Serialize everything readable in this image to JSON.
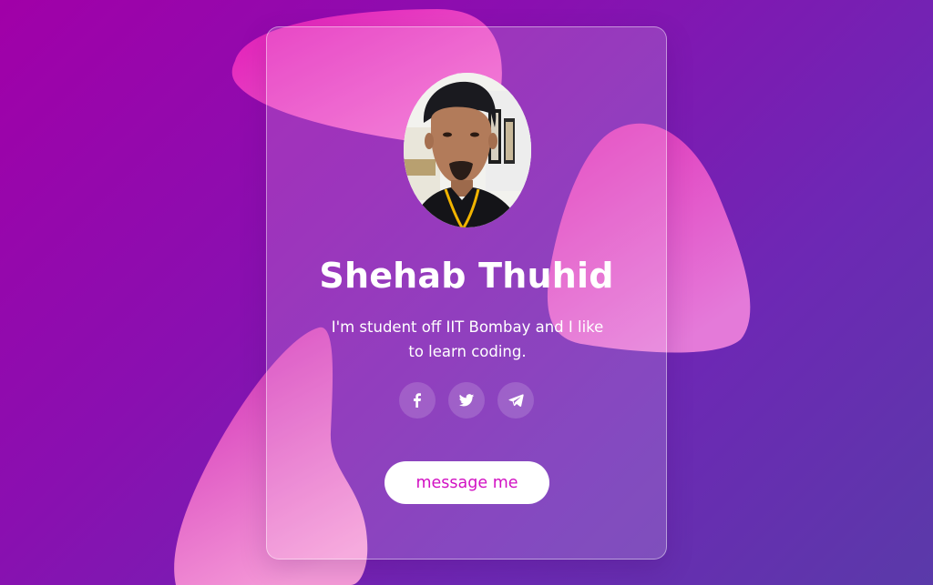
{
  "profile": {
    "name": "Shehab Thuhid",
    "bio": "I'm student off IIT Bombay and I like to learn coding.",
    "photo_alt": "profile photo"
  },
  "socials": [
    {
      "icon": "facebook-icon"
    },
    {
      "icon": "twitter-icon"
    },
    {
      "icon": "telegram-icon"
    }
  ],
  "cta": {
    "label": "message me"
  },
  "colors": {
    "bg_start": "#a100a8",
    "bg_end": "#5a3aa9",
    "blob_pink": "#e94bc7",
    "cta_text": "#d211c3"
  }
}
